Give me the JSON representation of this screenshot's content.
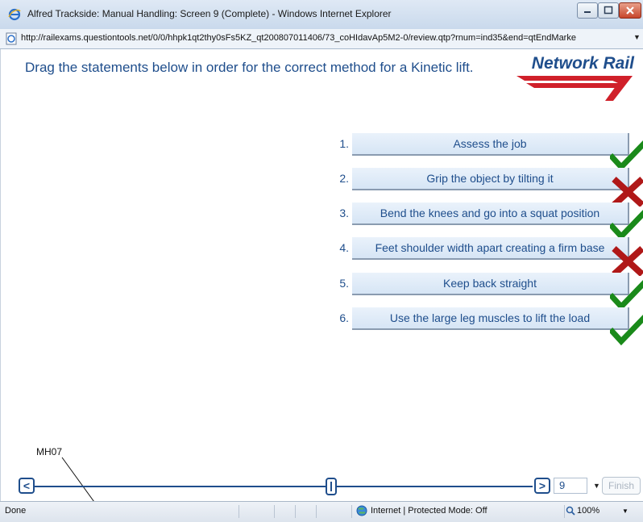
{
  "window": {
    "title": "Alfred Trackside: Manual Handling: Screen 9 (Complete) - Windows Internet Explorer",
    "address": "http://railexams.questiontools.net/0/0/hhpk1qt2thy0sFs5KZ_qt200807011406/73_coHIdavAp5M2-0/review.qtp?rnum=ind35&end=qtEndMarke"
  },
  "question": {
    "text": "Drag the statements below in order for the correct method for a Kinetic lift."
  },
  "logo": {
    "text": "Network Rail",
    "color": "#1f4e8c",
    "accent": "#d0202a"
  },
  "items": [
    {
      "num": "1.",
      "label": "Assess the job",
      "result": "correct"
    },
    {
      "num": "2.",
      "label": "Grip the object by tilting it",
      "result": "incorrect"
    },
    {
      "num": "3.",
      "label": "Bend the knees and go into a squat position",
      "result": "correct"
    },
    {
      "num": "4.",
      "label": "Feet shoulder width apart creating a firm base",
      "result": "incorrect"
    },
    {
      "num": "5.",
      "label": "Keep back straight",
      "result": "correct"
    },
    {
      "num": "6.",
      "label": "Use the large leg muscles to lift the load",
      "result": "correct"
    }
  ],
  "annotation": {
    "label": "MH07"
  },
  "navigation": {
    "prev_label": "<",
    "next_label": ">",
    "page_value": "9",
    "finish_label": "Finish"
  },
  "status": {
    "text": "Done",
    "zone": "Internet | Protected Mode: Off",
    "zoom": "100%"
  },
  "colors": {
    "correct": "#1a8a1a",
    "incorrect": "#b01818",
    "primary": "#1f4e8c"
  }
}
